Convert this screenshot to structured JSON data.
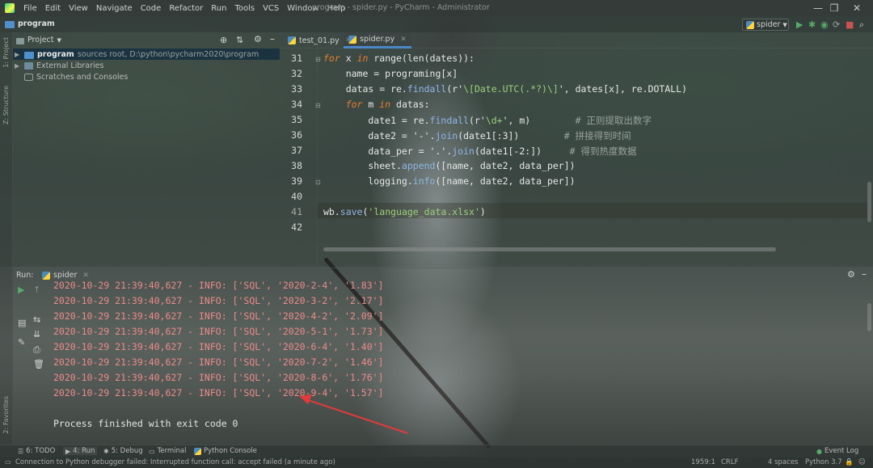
{
  "window": {
    "title": "program - spider.py - PyCharm - Administrator",
    "controls": [
      "—",
      "❐",
      "✕"
    ]
  },
  "menu": [
    "File",
    "Edit",
    "View",
    "Navigate",
    "Code",
    "Refactor",
    "Run",
    "Tools",
    "VCS",
    "Window",
    "Help"
  ],
  "navbar": {
    "project": "program",
    "run_config": "spider"
  },
  "left_strip": {
    "project_tab": "1: Project",
    "structure_tab": "Z: Structure",
    "favorites_tab": "2: Favorites"
  },
  "project_panel": {
    "dropdown": "Project",
    "tree": [
      {
        "name": "program",
        "detail": "sources root, D:\\python\\pycharm2020\\program",
        "icon": "folder-icon"
      },
      {
        "name": "External Libraries",
        "detail": "",
        "icon": "library-icon"
      },
      {
        "name": "Scratches and Consoles",
        "detail": "",
        "icon": "scratches-icon"
      }
    ]
  },
  "editor": {
    "tabs": [
      {
        "label": "test_01.py",
        "active": false
      },
      {
        "label": "spider.py",
        "active": true
      }
    ],
    "line_numbers": [
      "31",
      "32",
      "33",
      "34",
      "35",
      "36",
      "37",
      "38",
      "39",
      "40",
      "41",
      "42"
    ],
    "code": {
      "l31": {
        "kw1": "for",
        "a": " x ",
        "kw2": "in",
        "b": " range(len(dates)):"
      },
      "l32": {
        "a": "    name = programing[x]"
      },
      "l33": {
        "a": "    datas = re.",
        "fn": "findall",
        "b": "(r'",
        "s": "\\[Date.UTC(.*?)\\]",
        "c": "', dates[x], re.DOTALL)"
      },
      "l34": {
        "kw1": "    for",
        "a": " m ",
        "kw2": "in",
        "b": " datas:"
      },
      "l35": {
        "a": "        date1 = re.",
        "fn": "findall",
        "b": "(r'",
        "s": "\\d+",
        "c": "', m)",
        "cmt": "        # 正则提取出数字"
      },
      "l36": {
        "a": "        date2 = '-'.",
        "fn": "join",
        "b": "(date1[:3])",
        "cmt": "        # 拼接得到时间"
      },
      "l37": {
        "a": "        data_per = '.'.",
        "fn": "join",
        "b": "(date1[-2:])",
        "cmt": "     # 得到热度数据"
      },
      "l38": {
        "a": "        sheet.",
        "fn": "append",
        "b": "([name, date2, data_per])"
      },
      "l39": {
        "a": "        logging.",
        "fn": "info",
        "b": "([name, date2, data_per])"
      },
      "l41": {
        "a": "wb.",
        "fn": "save",
        "b": "(",
        "s": "'language_data.xlsx'",
        "c": ")"
      }
    }
  },
  "run_panel": {
    "label": "Run:",
    "tab": "spider",
    "output": [
      "2020-10-29 21:39:40,627 - INFO: ['SQL', '2020-2-4', '1.83']",
      "2020-10-29 21:39:40,627 - INFO: ['SQL', '2020-3-2', '2.17']",
      "2020-10-29 21:39:40,627 - INFO: ['SQL', '2020-4-2', '2.09']",
      "2020-10-29 21:39:40,627 - INFO: ['SQL', '2020-5-1', '1.73']",
      "2020-10-29 21:39:40,627 - INFO: ['SQL', '2020-6-4', '1.40']",
      "2020-10-29 21:39:40,627 - INFO: ['SQL', '2020-7-2', '1.46']",
      "2020-10-29 21:39:40,627 - INFO: ['SQL', '2020-8-6', '1.76']",
      "2020-10-29 21:39:40,627 - INFO: ['SQL', '2020-9-4', '1.57']"
    ],
    "finished": "Process finished with exit code 0"
  },
  "bottom_tools": {
    "todo": "6: TODO",
    "run": "4: Run",
    "debug": "5: Debug",
    "terminal": "Terminal",
    "python_console": "Python Console",
    "event_log": "Event Log"
  },
  "status": {
    "message": "Connection to Python debugger failed: Interrupted function call: accept failed (a minute ago)",
    "position": "1959:1",
    "line_sep": "CRLF",
    "indent": "4 spaces",
    "interpreter": "Python 3.7"
  },
  "colors": {
    "accent": "#4a88c7",
    "error_output": "#ec8a8a",
    "keyword": "#e87f2a",
    "string": "#9bd07a",
    "function": "#8fb6e6",
    "annotation_arrow": "#e23a3a"
  }
}
